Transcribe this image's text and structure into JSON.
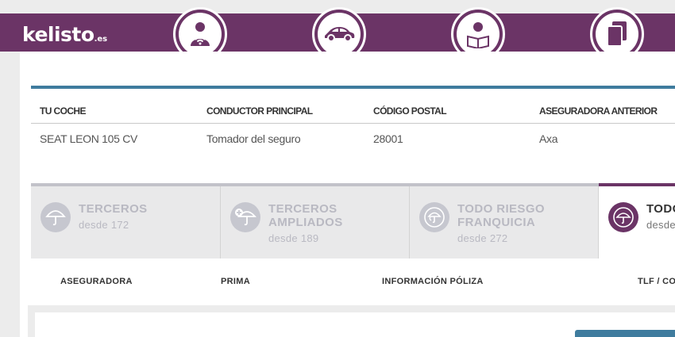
{
  "brand": {
    "name": "kelisto",
    "suffix": ".es"
  },
  "nav": [
    {
      "icon": "driver-wifi-icon"
    },
    {
      "icon": "car-icon"
    },
    {
      "icon": "reader-icon"
    },
    {
      "icon": "documents-icon"
    }
  ],
  "summary": {
    "labels": [
      "TU COCHE",
      "CONDUCTOR PRINCIPAL",
      "CÓDIGO POSTAL",
      "ASEGURADORA ANTERIOR"
    ],
    "values": [
      "SEAT LEON 105 CV",
      "Tomador del seguro",
      "28001",
      "Axa"
    ]
  },
  "tabs": [
    {
      "title1": "TERCEROS",
      "title2": "",
      "sub": "desde 172",
      "icon": "umbrella-icon"
    },
    {
      "title1": "TERCEROS",
      "title2": "AMPLIADOS",
      "sub": "desde 189",
      "icon": "umbrella-plus-icon"
    },
    {
      "title1": "TODO RIESGO",
      "title2": "FRANQUICIA",
      "sub": "desde 272",
      "icon": "umbrella-euro-icon"
    },
    {
      "title1": "TODO",
      "title2": "",
      "sub": "desde",
      "icon": "umbrella-icon"
    }
  ],
  "table_headers": [
    "ASEGURADORA",
    "PRIMA",
    "INFORMACIÓN PÓLIZA",
    "TLF / CO"
  ],
  "colors": {
    "brand": "#6b3466",
    "accent": "#3f7c9e",
    "tab_inactive": "#e9e9ea"
  }
}
